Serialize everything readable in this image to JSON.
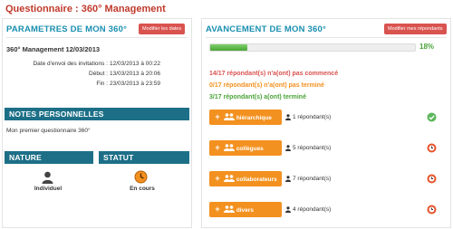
{
  "title": "Questionnaire : 360° Management",
  "left": {
    "params_header": "PARAMETRES DE MON 360°",
    "modify_dates_label": "Modifier les dates",
    "questionnaire_name": "360° Management 12/03/2013",
    "details": [
      {
        "label": "Date d'envoi des invitations :",
        "value": "12/03/2013 à 00:22"
      },
      {
        "label": "Début :",
        "value": "13/03/2013 à 20:06"
      },
      {
        "label": "Fin :",
        "value": "23/03/2013 à 23:59"
      }
    ],
    "notes_header": "NOTES PERSONNELLES",
    "notes_text": "Mon premier questionnaire 360°",
    "nature_header": "NATURE",
    "nature_value": "Individuel",
    "statut_header": "STATUT",
    "statut_value": "En cours"
  },
  "right": {
    "header": "AVANCEMENT DE MON 360°",
    "modify_respondents_label": "Modifier mes répondants",
    "progress": {
      "fraction": 0.18,
      "label": "18%"
    },
    "summary": [
      {
        "text": "14/17 répondant(s) n'a(ont) pas commencé",
        "color": "#d9534f"
      },
      {
        "text": "0/17 répondant(s) n'a(ont) pas terminé",
        "color": "#f39120"
      },
      {
        "text": "3/17 répondant(s) a(ont) terminé",
        "color": "#4aa438"
      }
    ],
    "groups": [
      {
        "label": "hiérarchique",
        "respondents": "1 répondant(s)",
        "state": "check"
      },
      {
        "label": "collègues",
        "respondents": "5 répondant(s)",
        "state": "pending"
      },
      {
        "label": "collaborateurs",
        "respondents": "7 répondant(s)",
        "state": "pending"
      },
      {
        "label": "divers",
        "respondents": "4 répondant(s)",
        "state": "pending"
      }
    ]
  },
  "colors": {
    "accent_red": "#c0392b",
    "teal": "#1d6f87",
    "orange": "#f39120",
    "green": "#4aa438",
    "header_blue": "#1a8fb0"
  }
}
